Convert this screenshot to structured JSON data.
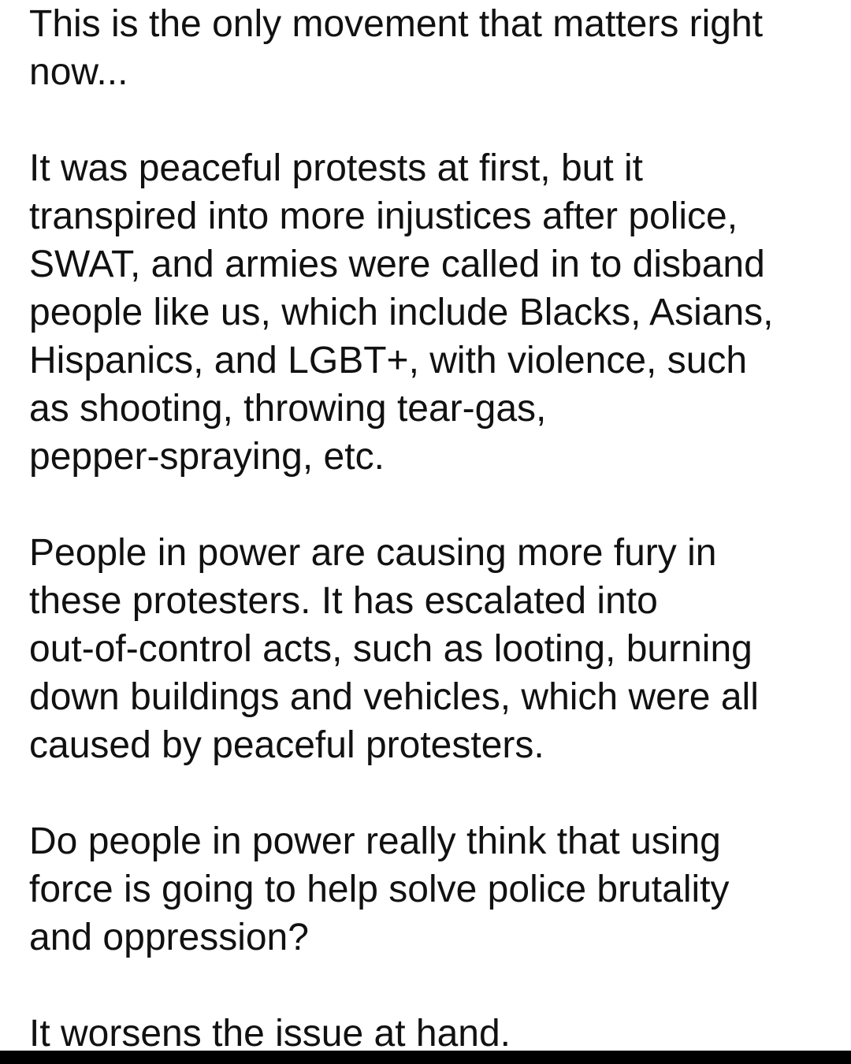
{
  "post": {
    "paragraphs": [
      {
        "lines": [
          "This is the only movement that matters right",
          "now..."
        ]
      },
      {
        "lines": [
          "It was peaceful protests at first, but it",
          "transpired into more injustices after police,",
          "SWAT, and armies were called in to disband",
          "people like us, which include Blacks, Asians,",
          "Hispanics, and LGBT+, with violence, such",
          "as shooting, throwing tear-gas,",
          "pepper-spraying, etc."
        ]
      },
      {
        "lines": [
          "People in power are causing more fury in",
          "these protesters. It has escalated into",
          "out-of-control acts, such as looting, burning",
          "down buildings and vehicles, which were all",
          "caused by peaceful protesters."
        ]
      },
      {
        "lines": [
          "Do people in power really think that using",
          "force is going to help solve police brutality",
          "and oppression?"
        ]
      },
      {
        "lines": [
          "It worsens the issue at hand."
        ]
      }
    ]
  }
}
